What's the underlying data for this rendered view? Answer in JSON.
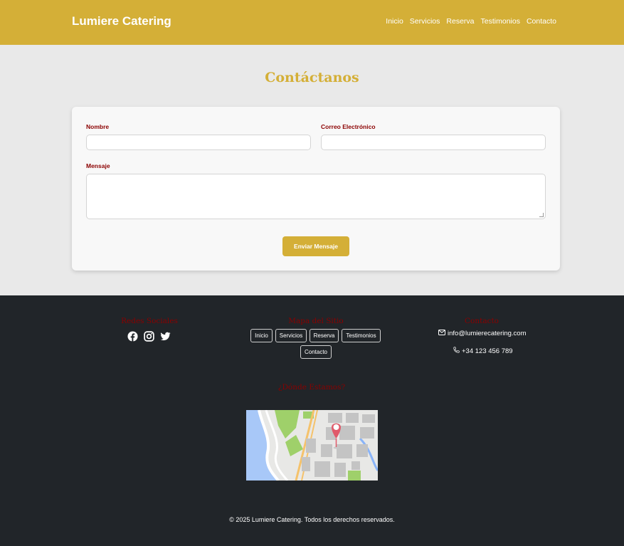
{
  "header": {
    "brand": "Lumiere Catering",
    "nav": [
      "Inicio",
      "Servicios",
      "Reserva",
      "Testimonios",
      "Contacto"
    ]
  },
  "contact": {
    "title": "Contáctanos",
    "name_label": "Nombre",
    "email_label": "Correo Electrónico",
    "message_label": "Mensaje",
    "name_value": "",
    "email_value": "",
    "message_value": "",
    "submit_label": "Enviar Mensaje"
  },
  "footer": {
    "social_title": "Redes Sociales",
    "social_icons": [
      "facebook-icon",
      "instagram-icon",
      "twitter-icon"
    ],
    "sitemap_title": "Mapa del Sitio",
    "sitemap_links": [
      "Inicio",
      "Servicios",
      "Reserva",
      "Testimonios",
      "Contacto"
    ],
    "contact_title": "Contacto",
    "email": "info@lumierecatering.com",
    "phone": "+34 123 456 789",
    "location_title": "¿Dónde Estamos?",
    "copyright": "© 2025 Lumiere Catering. Todos los derechos reservados."
  },
  "colors": {
    "brand_gold": "#d4af37",
    "label_red": "#8b0000",
    "footer_bg": "#212529",
    "page_bg": "#e9e9e9"
  }
}
